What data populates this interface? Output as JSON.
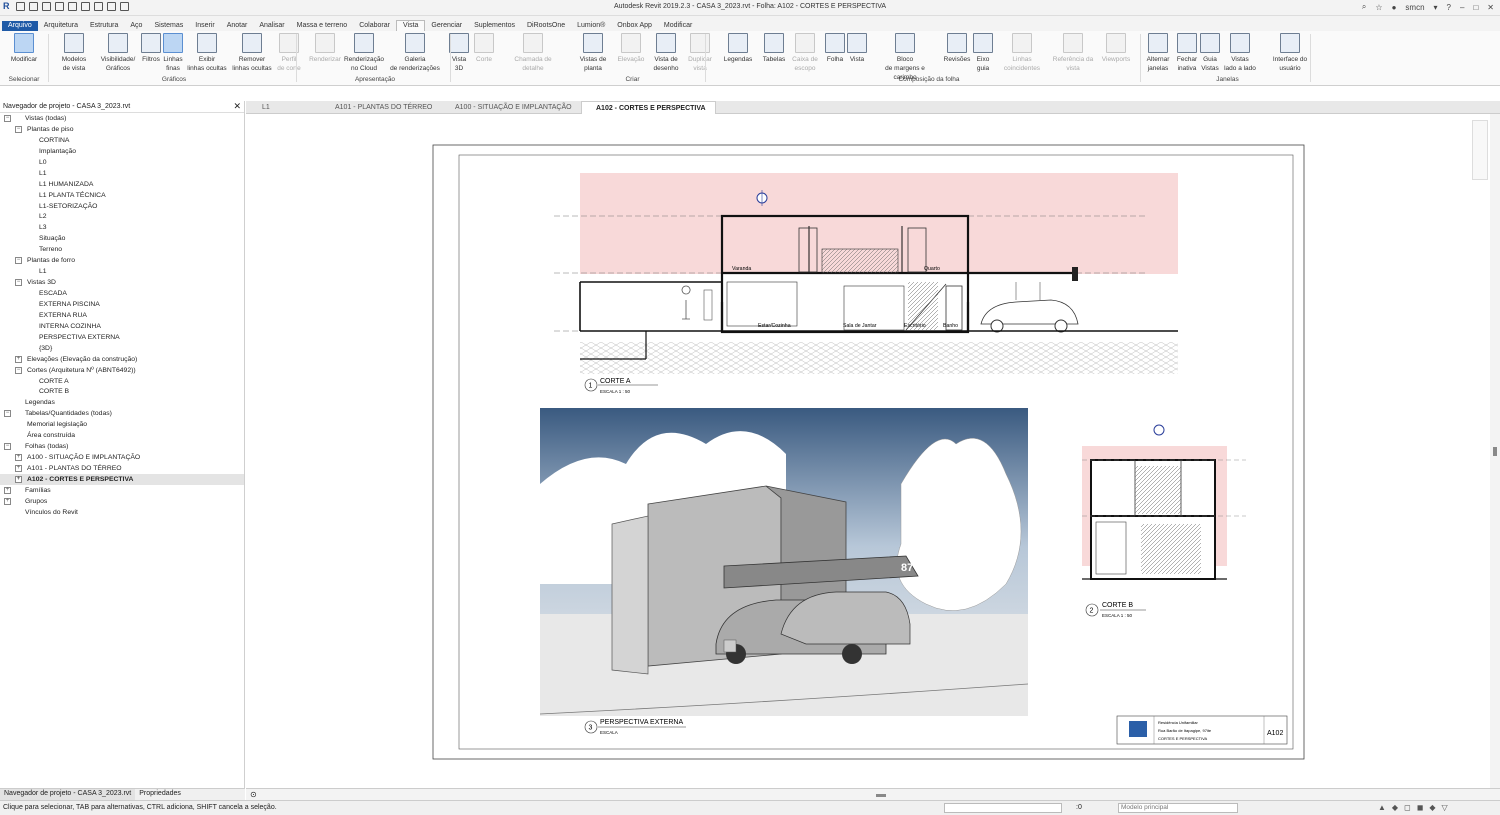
{
  "window": {
    "title": "Autodesk Revit 2019.2.3 - CASA 3_2023.rvt - Folha: A102 - CORTES E PERSPECTIVA",
    "user": "smcn"
  },
  "ribbon_tabs": [
    "Arquivo",
    "Arquitetura",
    "Estrutura",
    "Aço",
    "Sistemas",
    "Inserir",
    "Anotar",
    "Analisar",
    "Massa e terreno",
    "Colaborar",
    "Vista",
    "Gerenciar",
    "Suplementos",
    "DiRootsOne",
    "Lumion®",
    "Onbox App",
    "Modificar"
  ],
  "ribbon": {
    "buttons": [
      {
        "l1": "Modificar",
        "l2": "",
        "state": "sel"
      },
      {
        "l1": "Modelos",
        "l2": "de vista",
        "state": ""
      },
      {
        "l1": "Visibilidade/",
        "l2": "Gráficos",
        "state": ""
      },
      {
        "l1": "Filtros",
        "l2": "",
        "state": ""
      },
      {
        "l1": "Linhas",
        "l2": "finas",
        "state": "sel"
      },
      {
        "l1": "Exibir",
        "l2": "linhas ocultas",
        "state": ""
      },
      {
        "l1": "Remover",
        "l2": "linhas ocultas",
        "state": ""
      },
      {
        "l1": "Perfil",
        "l2": "de corte",
        "state": "dis"
      },
      {
        "l1": "Renderizar",
        "l2": "",
        "state": "dis"
      },
      {
        "l1": "Renderização",
        "l2": "no Cloud",
        "state": ""
      },
      {
        "l1": "Galeria",
        "l2": "de renderizações",
        "state": ""
      },
      {
        "l1": "Vista",
        "l2": "3D",
        "state": ""
      },
      {
        "l1": "Corte",
        "l2": "",
        "state": "dis"
      },
      {
        "l1": "Chamada de detalhe",
        "l2": "",
        "state": "dis"
      },
      {
        "l1": "Vistas de",
        "l2": "planta",
        "state": ""
      },
      {
        "l1": "Elevação",
        "l2": "",
        "state": "dis"
      },
      {
        "l1": "Vista de",
        "l2": "desenho",
        "state": ""
      },
      {
        "l1": "Duplicar",
        "l2": "vista",
        "state": "dis"
      },
      {
        "l1": "Legendas",
        "l2": "",
        "state": ""
      },
      {
        "l1": "Tabelas",
        "l2": "",
        "state": ""
      },
      {
        "l1": "Caixa de",
        "l2": "escopo",
        "state": "dis"
      },
      {
        "l1": "Folha",
        "l2": "",
        "state": ""
      },
      {
        "l1": "Vista",
        "l2": "",
        "state": ""
      },
      {
        "l1": "Bloco",
        "l2": "de margens e carimbo",
        "state": ""
      },
      {
        "l1": "Revisões",
        "l2": "",
        "state": ""
      },
      {
        "l1": "Eixo",
        "l2": "guia",
        "state": ""
      },
      {
        "l1": "Linhas coincidentes",
        "l2": "",
        "state": "dis"
      },
      {
        "l1": "Referência da",
        "l2": "vista",
        "state": "dis"
      },
      {
        "l1": "Viewports",
        "l2": "",
        "state": "dis"
      },
      {
        "l1": "Alternar",
        "l2": "janelas",
        "state": ""
      },
      {
        "l1": "Fechar",
        "l2": "inativa",
        "state": ""
      },
      {
        "l1": "Guia",
        "l2": "Vistas",
        "state": ""
      },
      {
        "l1": "Vistas",
        "l2": "lado a lado",
        "state": ""
      },
      {
        "l1": "Interface do",
        "l2": "usuário",
        "state": ""
      }
    ],
    "groups": [
      "Selecionar",
      "Gráficos",
      "Apresentação",
      "Criar",
      "Composição da folha",
      "Janelas"
    ]
  },
  "browser": {
    "title": "Navegador de projeto - CASA 3_2023.rvt",
    "tree": [
      {
        "t": "Vistas (todas)",
        "d": 0,
        "ex": "-"
      },
      {
        "t": "Plantas de piso",
        "d": 1,
        "ex": "-"
      },
      {
        "t": "CORTINA",
        "d": 2,
        "ex": ""
      },
      {
        "t": "Implantação",
        "d": 2,
        "ex": ""
      },
      {
        "t": "L0",
        "d": 2,
        "ex": ""
      },
      {
        "t": "L1",
        "d": 2,
        "ex": ""
      },
      {
        "t": "L1 HUMANIZADA",
        "d": 2,
        "ex": ""
      },
      {
        "t": "L1 PLANTA TÉCNICA",
        "d": 2,
        "ex": ""
      },
      {
        "t": "L1-SETORIZAÇÃO",
        "d": 2,
        "ex": ""
      },
      {
        "t": "L2",
        "d": 2,
        "ex": ""
      },
      {
        "t": "L3",
        "d": 2,
        "ex": ""
      },
      {
        "t": "Situação",
        "d": 2,
        "ex": ""
      },
      {
        "t": "Terreno",
        "d": 2,
        "ex": ""
      },
      {
        "t": "Plantas de forro",
        "d": 1,
        "ex": "-"
      },
      {
        "t": "L1",
        "d": 2,
        "ex": ""
      },
      {
        "t": "Vistas 3D",
        "d": 1,
        "ex": "-"
      },
      {
        "t": "ESCADA",
        "d": 2,
        "ex": ""
      },
      {
        "t": "EXTERNA PISCINA",
        "d": 2,
        "ex": ""
      },
      {
        "t": "EXTERNA RUA",
        "d": 2,
        "ex": ""
      },
      {
        "t": "INTERNA COZINHA",
        "d": 2,
        "ex": ""
      },
      {
        "t": "PERSPECTIVA EXTERNA",
        "d": 2,
        "ex": ""
      },
      {
        "t": "{3D}",
        "d": 2,
        "ex": ""
      },
      {
        "t": "Elevações (Elevação da construção)",
        "d": 1,
        "ex": "+"
      },
      {
        "t": "Cortes (Arquitetura Nº (ABNT6492))",
        "d": 1,
        "ex": "-"
      },
      {
        "t": "CORTE A",
        "d": 2,
        "ex": ""
      },
      {
        "t": "CORTE B",
        "d": 2,
        "ex": ""
      },
      {
        "t": "Legendas",
        "d": 0,
        "ex": ""
      },
      {
        "t": "Tabelas/Quantidades (todas)",
        "d": 0,
        "ex": "-"
      },
      {
        "t": "Memorial legislação",
        "d": 1,
        "ex": ""
      },
      {
        "t": "Área construída",
        "d": 1,
        "ex": ""
      },
      {
        "t": "Folhas (todas)",
        "d": 0,
        "ex": "-"
      },
      {
        "t": "A100 - SITUAÇÃO E IMPLANTAÇÃO",
        "d": 1,
        "ex": "+"
      },
      {
        "t": "A101 - PLANTAS DO TÉRREO",
        "d": 1,
        "ex": "+"
      },
      {
        "t": "A102 - CORTES E PERSPECTIVA",
        "d": 1,
        "ex": "+",
        "bold": true
      },
      {
        "t": "Famílias",
        "d": 0,
        "ex": "+"
      },
      {
        "t": "Grupos",
        "d": 0,
        "ex": "+"
      },
      {
        "t": "Vínculos do Revit",
        "d": 0,
        "ex": ""
      }
    ],
    "footer_tabs": [
      "Navegador de projeto - CASA 3_2023.rvt",
      "Propriedades"
    ]
  },
  "view_tabs": [
    {
      "label": "L1",
      "active": false
    },
    {
      "label": "A101 - PLANTAS DO TÉRREO",
      "active": false
    },
    {
      "label": "A100 - SITUAÇÃO E IMPLANTAÇÃO",
      "active": false
    },
    {
      "label": "A102 - CORTES E PERSPECTIVA",
      "active": true
    }
  ],
  "sheet": {
    "corte_a": {
      "num": "1",
      "title": "CORTE A",
      "scale": "ESCALA 1 : 50"
    },
    "corte_b": {
      "num": "2",
      "title": "CORTE B",
      "scale": "ESCALA 1 : 50"
    },
    "perspectiva": {
      "num": "3",
      "title": "PERSPECTIVA EXTERNA",
      "scale": "ESCALA"
    },
    "rooms": [
      "Varanda",
      "Quarto",
      "Estar/Cozinha",
      "Sala de Jantar",
      "Escritório",
      "Banho"
    ],
    "house_number": "87",
    "sheet_number": "A102",
    "tb_lines": [
      "Residência Unifamiliar",
      "Rua Barão de Itapagipe, 97ite",
      "CORTES E PERSPECTIVA"
    ]
  },
  "status": {
    "message": "Clique para selecionar, TAB para alternativas, CTRL adiciona, SHIFT cancela a seleção.",
    "model": "Modelo principal",
    "count": ":0"
  }
}
